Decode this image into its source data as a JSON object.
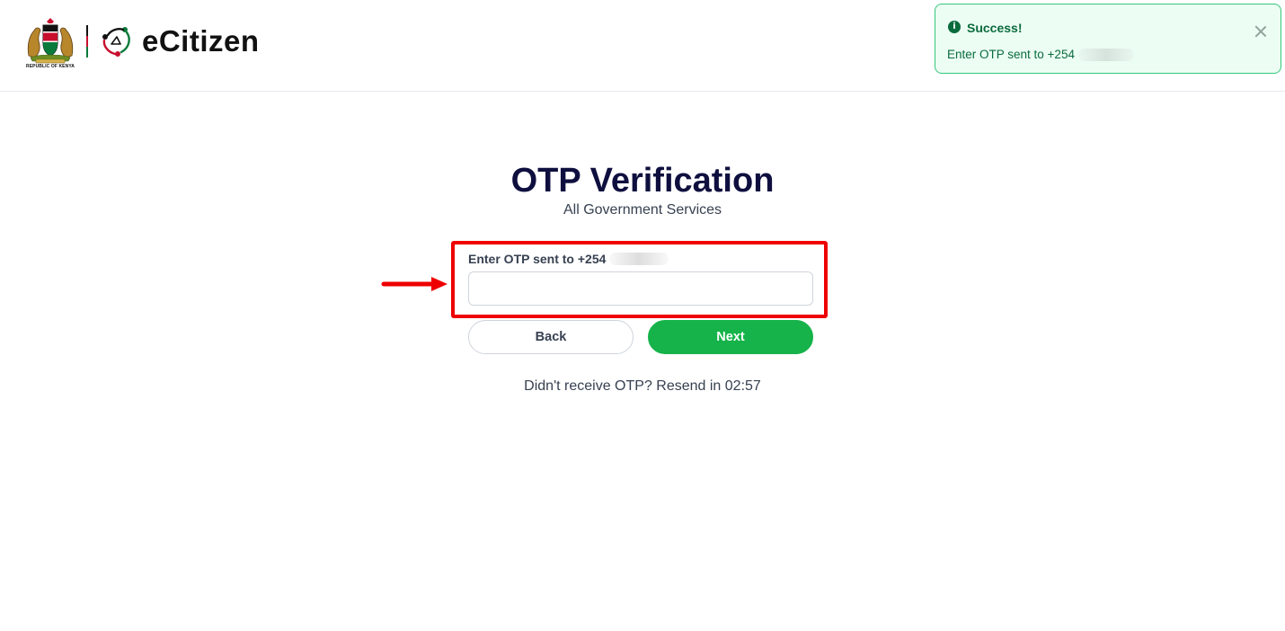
{
  "header": {
    "coat_caption": "REPUBLIC OF KENYA",
    "logo_text": "eCitizen"
  },
  "toast": {
    "title": "Success!",
    "message": "Enter OTP sent to +254",
    "icon": "info-icon",
    "close_icon": "close-icon"
  },
  "main": {
    "title": "OTP Verification",
    "subtitle": "All Government Services",
    "otp_label": "Enter OTP sent to +254",
    "otp_value": "",
    "back_label": "Back",
    "next_label": "Next",
    "resend_text": "Didn't receive OTP? Resend in 02:57"
  },
  "annotation": {
    "highlight_color": "#ee0000",
    "arrow_icon": "arrow-right-icon"
  },
  "colors": {
    "primary_green": "#16b34a",
    "title_navy": "#0f0f3f",
    "toast_bg": "#ecfdf3",
    "toast_border": "#34c77b",
    "toast_text": "#0a6b3d"
  }
}
